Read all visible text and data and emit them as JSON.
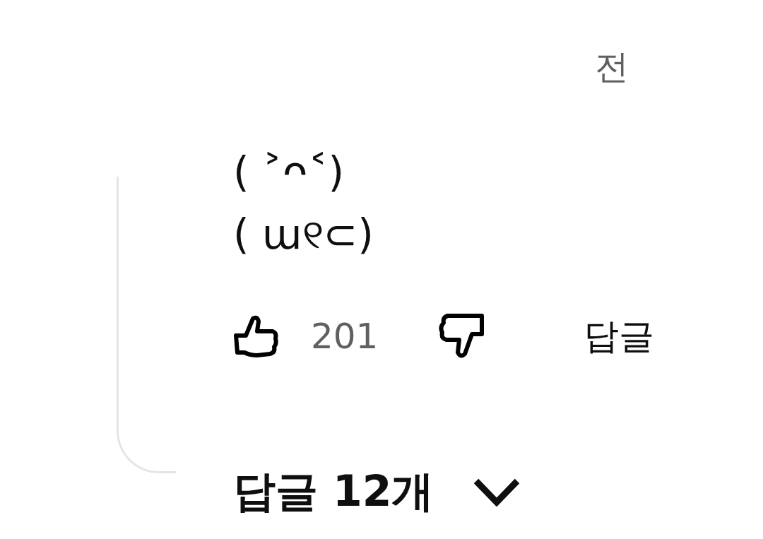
{
  "comment": {
    "timestamp": "전",
    "text_lines": [
      "( ˃ᴖ˂)",
      "( ա୧⊂)"
    ],
    "like_count": "201",
    "reply_button": "답글",
    "replies_toggle": {
      "label": "답글 12개",
      "expanded": false
    }
  }
}
